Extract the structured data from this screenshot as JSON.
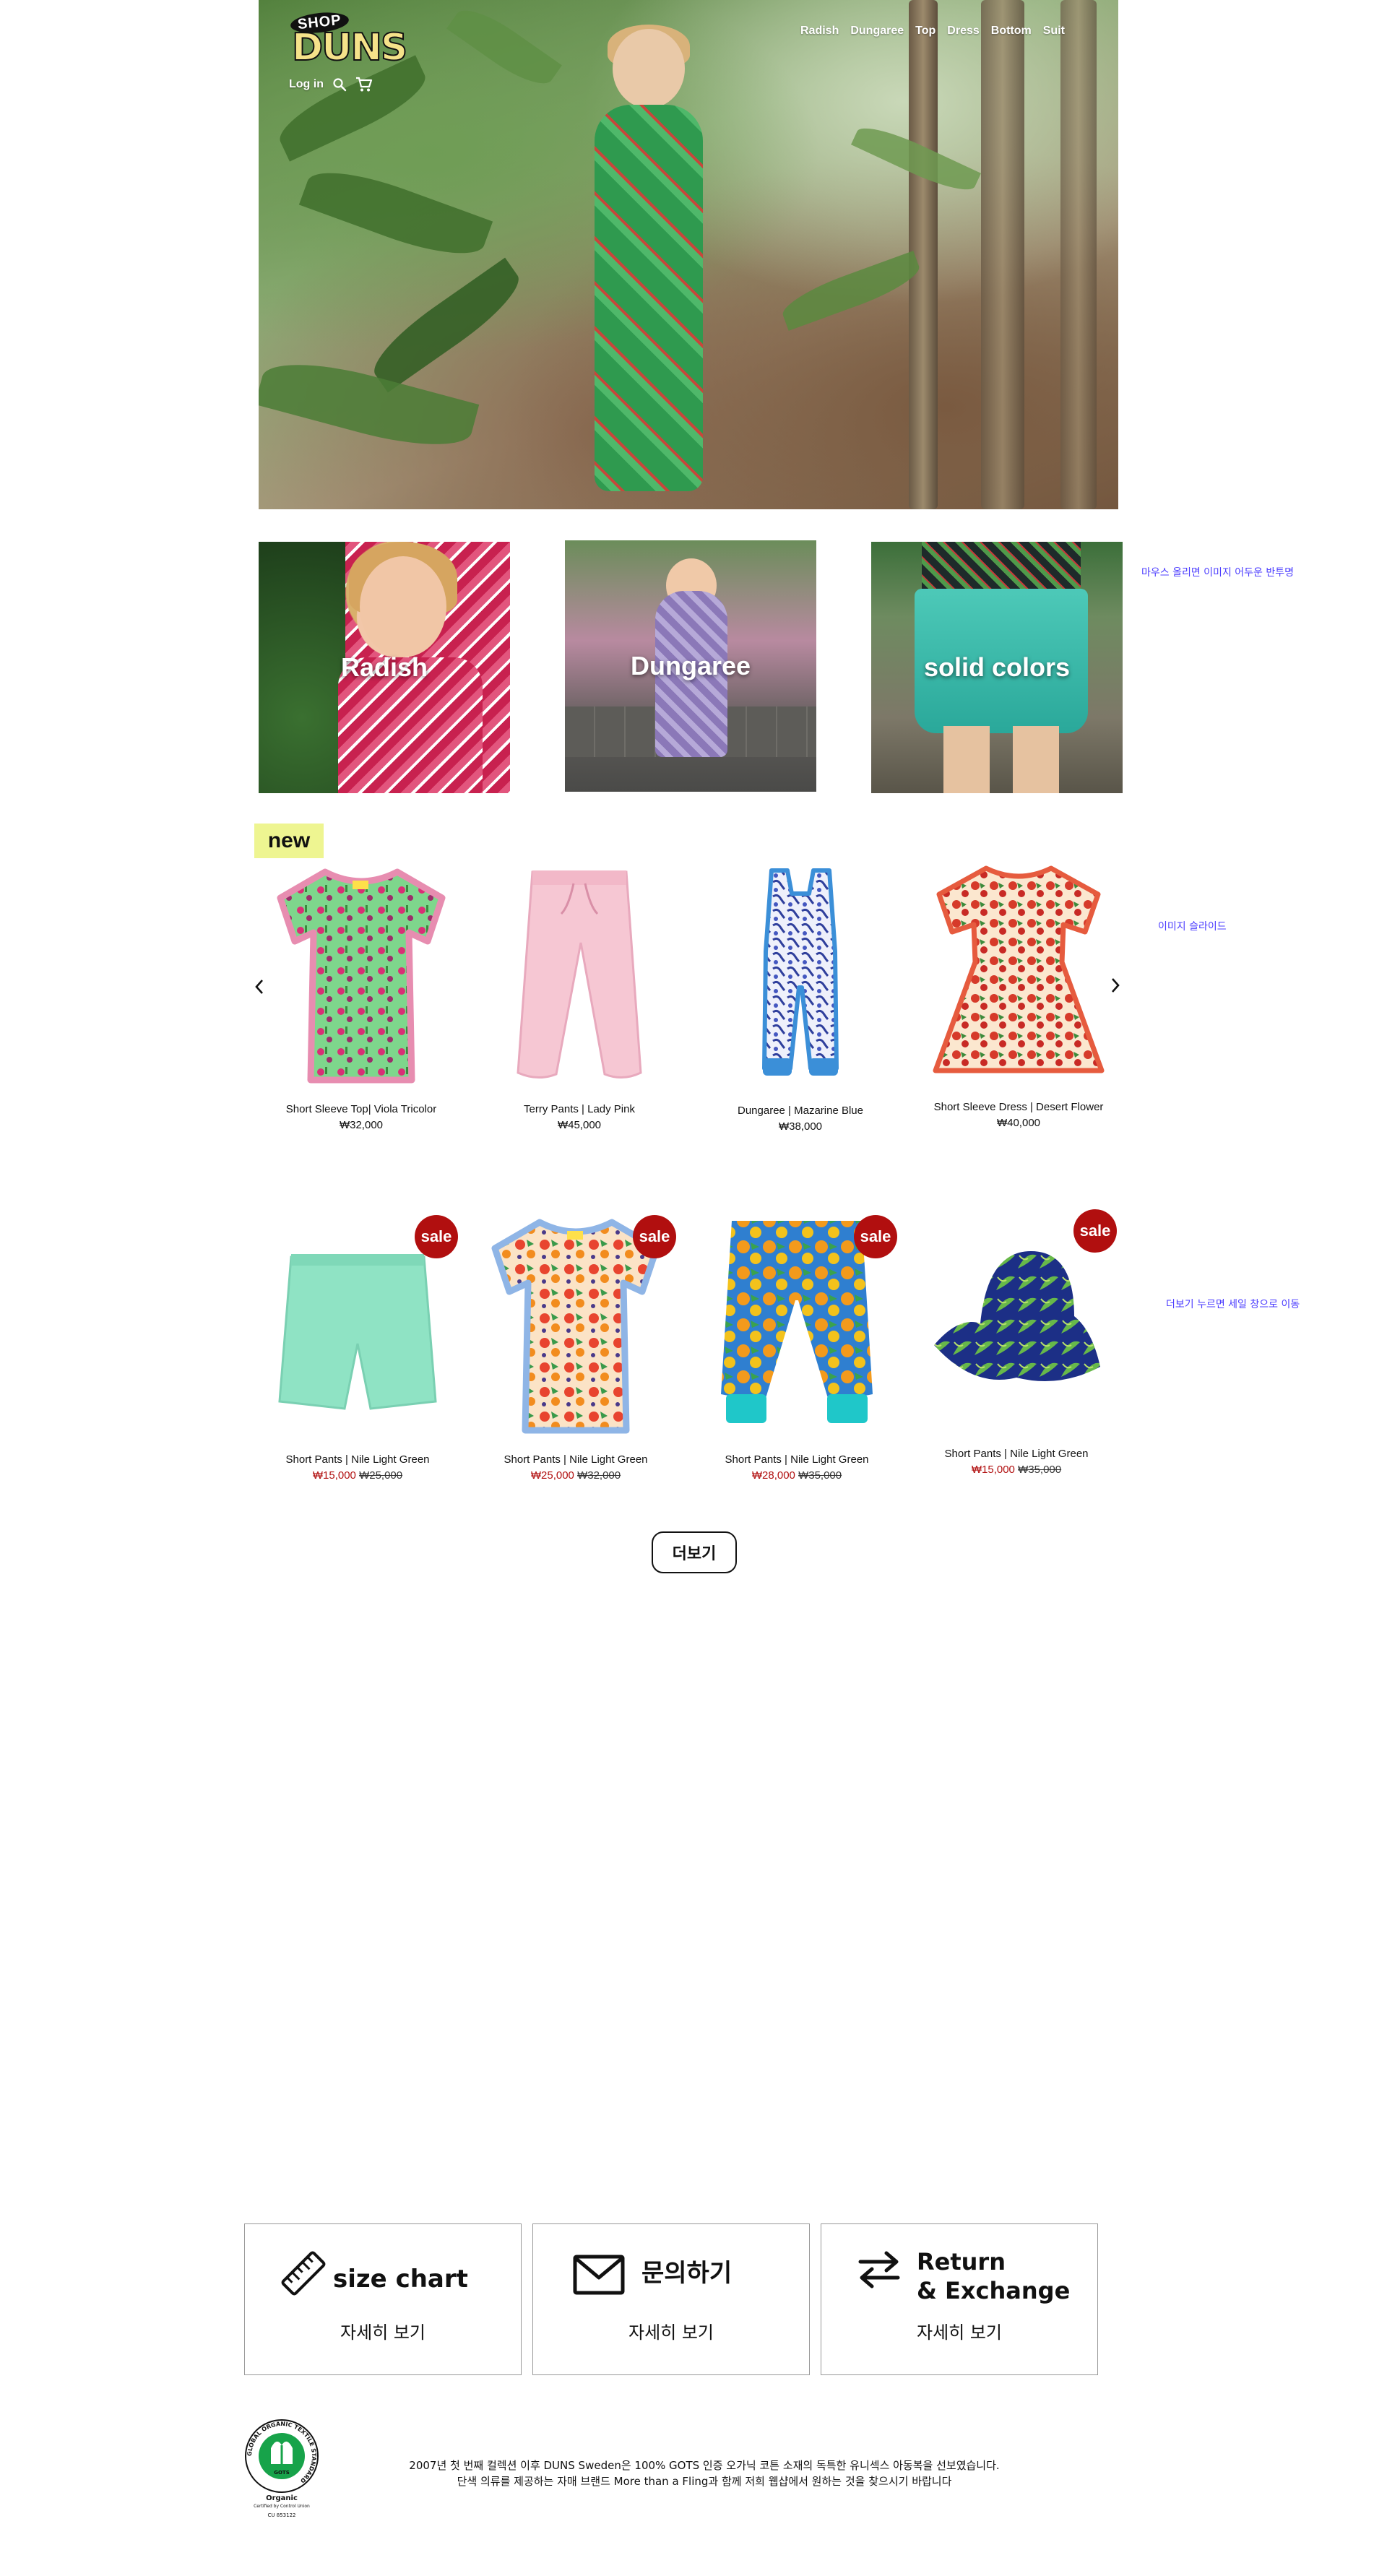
{
  "brand": {
    "shop": "SHOP",
    "name": "DUNS"
  },
  "nav": {
    "items": [
      "Radish",
      "Dungaree",
      "Top",
      "Dress",
      "Bottom",
      "Suit"
    ]
  },
  "utility": {
    "login": "Log in"
  },
  "categories": [
    {
      "label": "Radish"
    },
    {
      "label": "Dungaree"
    },
    {
      "label": "solid colors"
    }
  ],
  "notes": {
    "hover": "마우스 올리면 이미지  어두운 반투명",
    "slide": "이미지 슬라이드",
    "more": "더보기 누르면 세일 창으로 이동"
  },
  "new_section": {
    "badge": "new",
    "products": [
      {
        "name": "Short Sleeve Top| Viola Tricolor",
        "price": "₩32,000"
      },
      {
        "name": "Terry Pants | Lady Pink",
        "price": "₩45,000"
      },
      {
        "name": "Dungaree | Mazarine Blue",
        "price": "₩38,000"
      },
      {
        "name": "Short Sleeve  Dress | Desert Flower",
        "price": "₩40,000"
      }
    ]
  },
  "sale_section": {
    "badge": "sale",
    "products": [
      {
        "name": "Short Pants | Nile Light Green",
        "sale_price": "₩15,000",
        "orig_price": "₩25,000"
      },
      {
        "name": "Short Pants | Nile Light Green",
        "sale_price": "₩25,000",
        "orig_price": "₩32,000"
      },
      {
        "name": "Short Pants | Nile Light Green",
        "sale_price": "₩28,000",
        "orig_price": "₩35,000"
      },
      {
        "name": "Short Pants | Nile Light Green",
        "sale_price": "₩15,000",
        "orig_price": "₩35,000"
      }
    ],
    "more_label": "더보기"
  },
  "info_boxes": [
    {
      "title": "size chart",
      "link": "자세히 보기",
      "icon": "ruler-icon"
    },
    {
      "title": "문의하기",
      "link": "자세히 보기",
      "icon": "mail-icon"
    },
    {
      "title_line1": "Return",
      "title_line2": "& Exchange",
      "link": "자세히 보기",
      "icon": "exchange-arrows-icon"
    }
  ],
  "gots": {
    "ring": "GLOBAL ORGANIC TEXTILE STANDARD",
    "center": "GOTS",
    "organic": "Organic",
    "certified": "Certified by Control Union",
    "cu": "CU 853122"
  },
  "footer": {
    "line1": "2007년 첫 번째 컬렉션 이후 DUNS Sweden은 100% GOTS 인증 오가닉 코튼 소재의 독특한 유니섹스 아동복을 선보였습니다.",
    "line2": "단색 의류를 제공하는 자매 브랜드 More than a Fling과 함께 저희 웹샵에서 원하는 것을 찾으시기 바랍니다"
  },
  "colors": {
    "sale_red": "#b10f0f",
    "new_badge": "#eef591",
    "note_blue": "#4b3cff",
    "logo_yellow": "#f5e28a"
  }
}
